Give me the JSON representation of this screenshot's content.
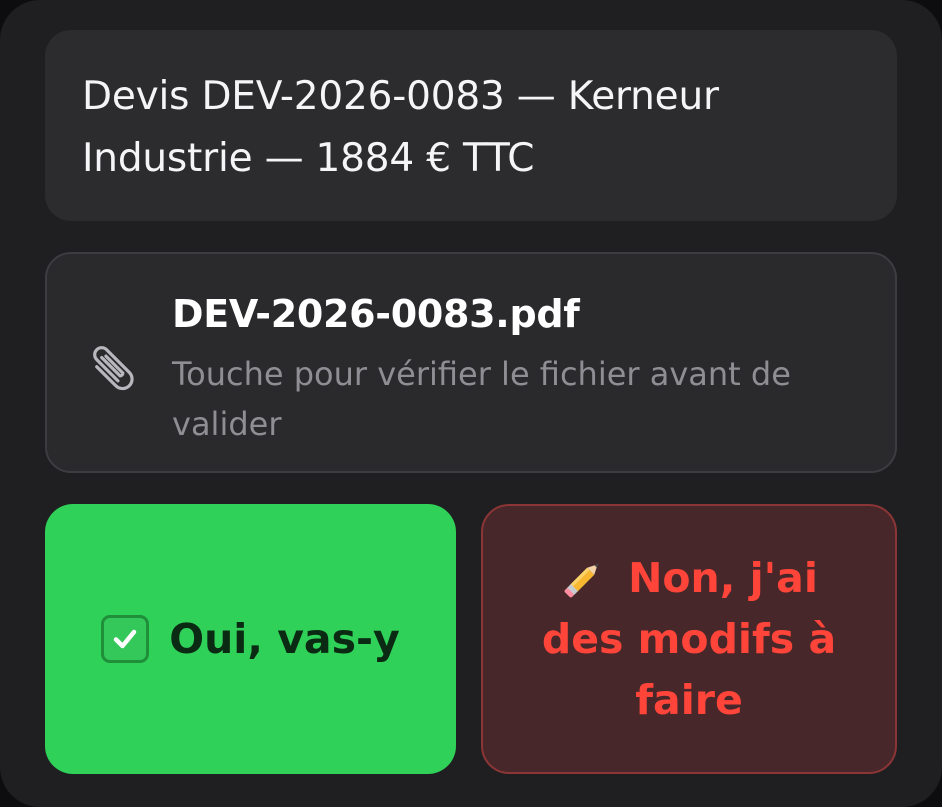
{
  "summary": {
    "text": "Devis DEV-2026-0083 — Kerneur Industrie — 1884 € TTC"
  },
  "attachment": {
    "icon": "paperclip-icon",
    "filename": "DEV-2026-0083.pdf",
    "hint": "Touche pour vérifier le fichier avant de valider"
  },
  "actions": {
    "confirm": {
      "icon": "check-mark-button-icon",
      "label": "Oui, vas-y",
      "color": "#30d158"
    },
    "edit": {
      "icon": "pencil-icon",
      "label": "Non, j'ai des modifs à faire",
      "color": "#ff453a"
    }
  }
}
